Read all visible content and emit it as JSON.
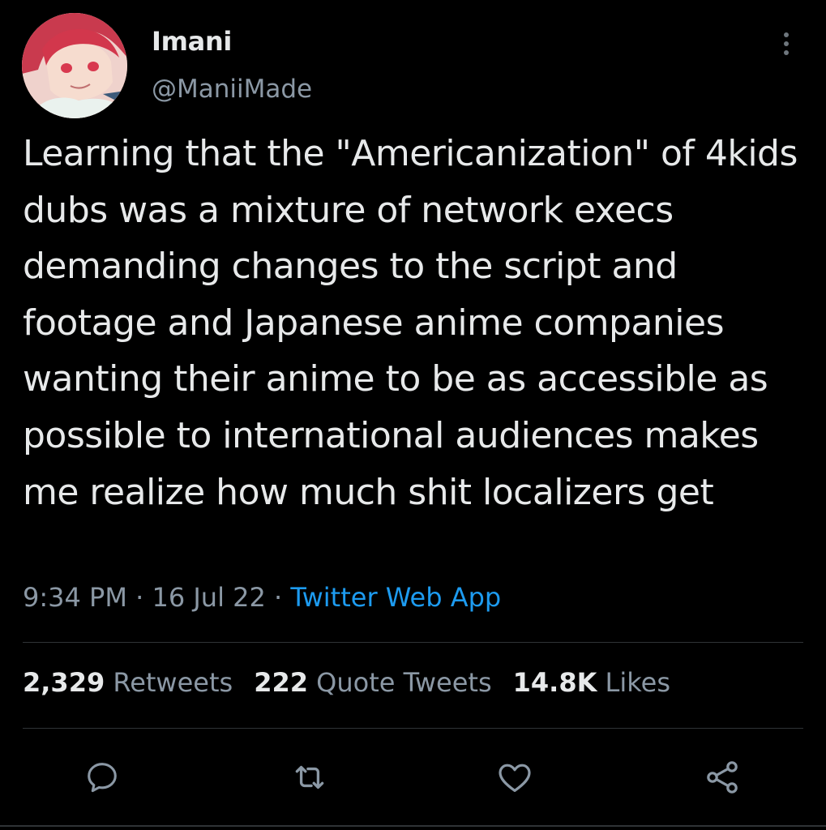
{
  "author": {
    "name": "Imani",
    "handle": "@ManiiMade",
    "avatar_icon": "anime-character-avatar"
  },
  "tweet": {
    "text": "Learning that the \"Americanization\" of 4kids dubs was a mixture of network execs demanding changes to the script and footage and Japanese anime companies wanting their anime to be as accessible as possible to international audiences makes me realize how much shit localizers get",
    "time": "9:34 PM",
    "separator": "·",
    "date": "16 Jul 22",
    "source": "Twitter Web App"
  },
  "stats": {
    "retweets_count": "2,329",
    "retweets_label": "Retweets",
    "quotes_count": "222",
    "quotes_label": "Quote Tweets",
    "likes_count": "14.8K",
    "likes_label": "Likes"
  },
  "actions": [
    "reply-icon",
    "retweet-icon",
    "like-icon",
    "share-icon"
  ],
  "colors": {
    "background": "#000000",
    "text": "#e7e9ea",
    "secondary": "#8b98a5",
    "link": "#1d9bf0",
    "divider": "#2f3336"
  }
}
